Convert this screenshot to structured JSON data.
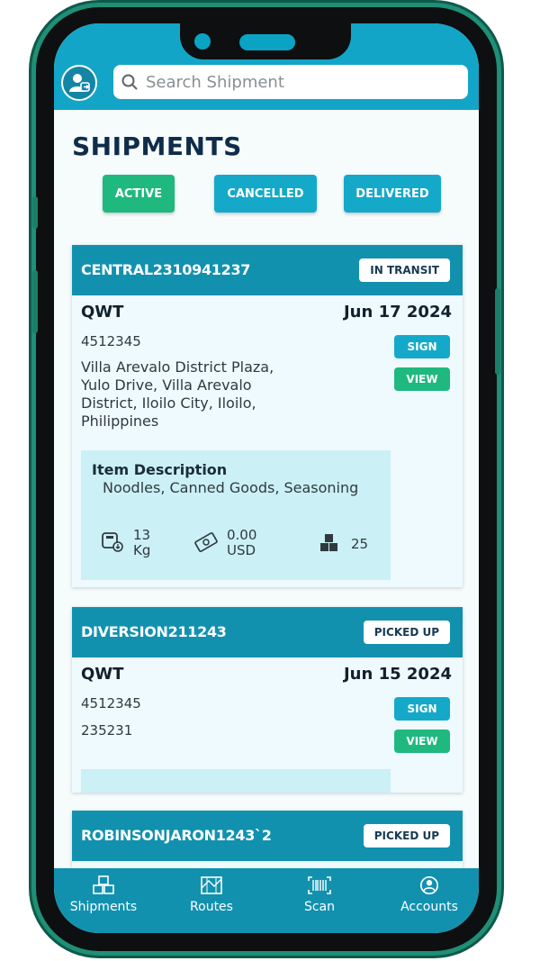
{
  "search": {
    "placeholder": "Search Shipment"
  },
  "page": {
    "title": "SHIPMENTS"
  },
  "filters": [
    {
      "label": "ACTIVE",
      "color": "#1fb87f"
    },
    {
      "label": "CANCELLED",
      "color": "#15a9c9"
    },
    {
      "label": "DELIVERED",
      "color": "#15a9c9"
    }
  ],
  "shipments": [
    {
      "code": "CENTRAL2310941237",
      "status": "IN TRANSIT",
      "carrier": "QWT",
      "date": "Jun 17 2024",
      "tracking": "4512345",
      "address": "Villa Arevalo District Plaza, Yulo Drive, Villa Arevalo District, Iloilo City, Iloilo, Philippines",
      "sign_label": "SIGN",
      "view_label": "VIEW",
      "item_description_label": "Item Description",
      "item_description": "Noodles, Canned Goods, Seasoning",
      "weight_value": "13",
      "weight_unit": "Kg",
      "price_value": "0.00",
      "price_unit": "USD",
      "quantity": "25"
    },
    {
      "code": "DIVERSION211243",
      "status": "PICKED UP",
      "carrier": "QWT",
      "date": "Jun 15 2024",
      "tracking": "4512345",
      "reference": "235231",
      "sign_label": "SIGN",
      "view_label": "VIEW"
    },
    {
      "code": "ROBINSONJARON1243`2",
      "status": "PICKED UP"
    }
  ],
  "nav": [
    {
      "label": "Shipments",
      "icon": "boxes-icon"
    },
    {
      "label": "Routes",
      "icon": "map-icon"
    },
    {
      "label": "Scan",
      "icon": "barcode-icon"
    },
    {
      "label": "Accounts",
      "icon": "user-circle-icon"
    }
  ],
  "colors": {
    "primary": "#13a5c7",
    "header_dark": "#1291af",
    "green": "#1fb87f",
    "frame_green": "#1f8f76"
  }
}
